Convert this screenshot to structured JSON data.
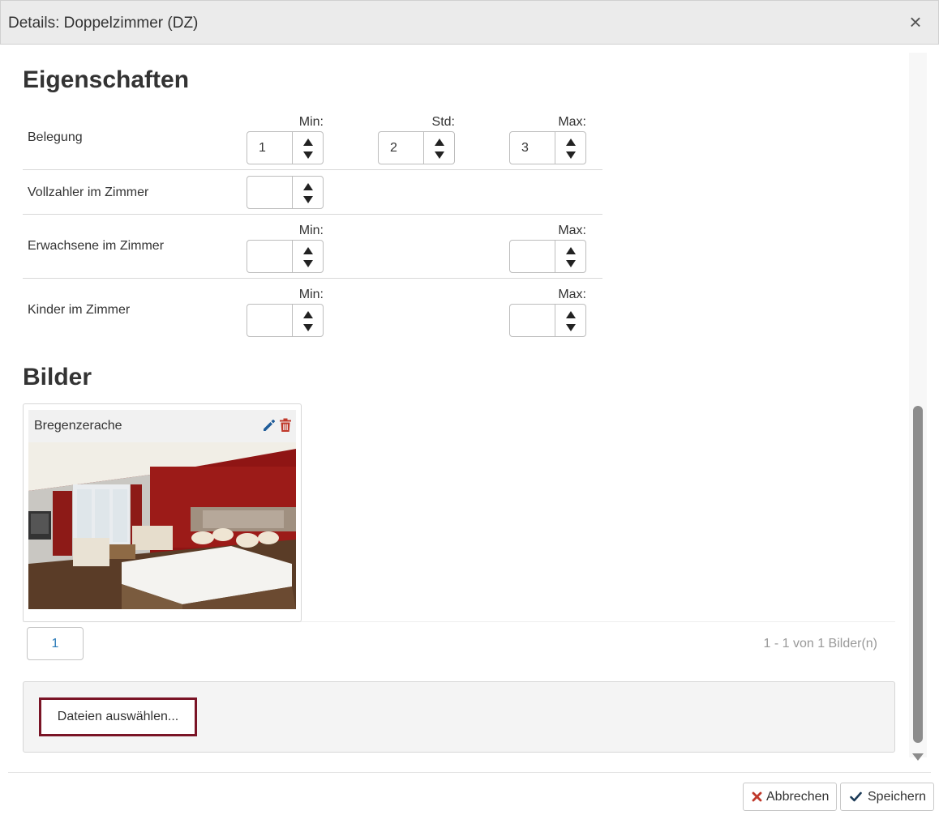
{
  "dialog": {
    "title": "Details: Doppelzimmer (DZ)",
    "close_icon": "×"
  },
  "sections": {
    "properties": "Eigenschaften",
    "images": "Bilder"
  },
  "rows": {
    "belegung": {
      "label": "Belegung",
      "min_label": "Min:",
      "std_label": "Std:",
      "max_label": "Max:",
      "min": "1",
      "std": "2",
      "max": "3"
    },
    "vollzahler": {
      "label": "Vollzahler im Zimmer",
      "value": ""
    },
    "erwachsene": {
      "label": "Erwachsene im Zimmer",
      "min_label": "Min:",
      "max_label": "Max:",
      "min": "",
      "max": ""
    },
    "kinder": {
      "label": "Kinder im Zimmer",
      "min_label": "Min:",
      "max_label": "Max:",
      "min": "",
      "max": ""
    }
  },
  "gallery": {
    "items": [
      {
        "name": "Bregenzerache",
        "edit_icon": "pencil-icon",
        "delete_icon": "trash-icon"
      }
    ],
    "page": "1",
    "info": "1 - 1 von 1 Bilder(n)"
  },
  "upload": {
    "button_label": "Dateien auswählen..."
  },
  "footer": {
    "cancel_label": "Abbrechen",
    "save_label": "Speichern"
  },
  "colors": {
    "accent_border": "#7a1426",
    "edit_blue": "#1f5c99",
    "delete_red": "#c0392b",
    "pager_link": "#2a7ab8"
  }
}
